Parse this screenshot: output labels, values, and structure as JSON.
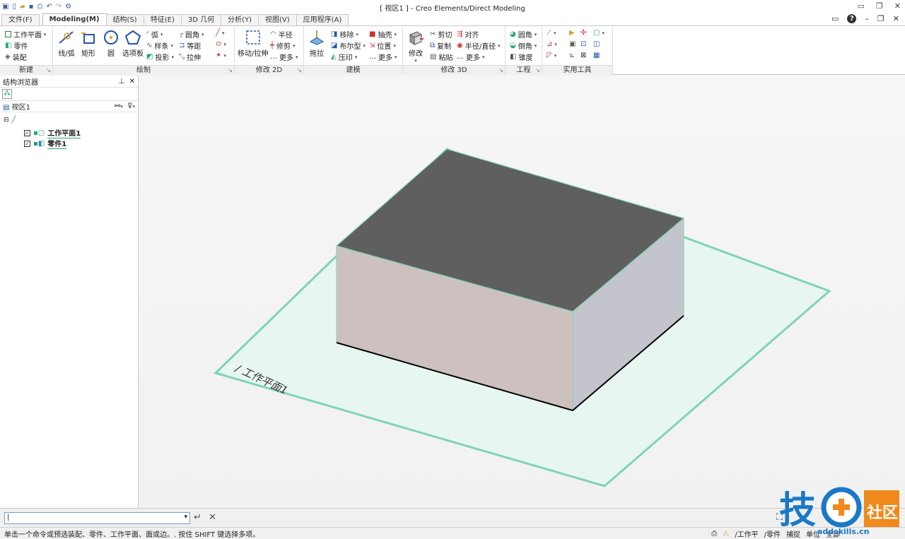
{
  "window": {
    "title": "[ 视区1 ] - Creo Elements/Direct Modeling"
  },
  "tabs": [
    {
      "label": "文件(F)"
    },
    {
      "label": "Modeling(M)"
    },
    {
      "label": "结构(S)"
    },
    {
      "label": "特征(E)"
    },
    {
      "label": "3D 几何"
    },
    {
      "label": "分析(Y)"
    },
    {
      "label": "视图(V)"
    },
    {
      "label": "应用程序(A)"
    }
  ],
  "ribbon": {
    "new": {
      "label": "新建",
      "items": [
        "工作平面",
        "零件",
        "装配"
      ]
    },
    "draw": {
      "label": "绘制",
      "line_arc": "线/弧",
      "rect": "矩形",
      "circle": "圆",
      "polygon": "选项板",
      "arc": "弧",
      "spline": "样条",
      "project": "投影",
      "fillet": "圆角",
      "offset": "等距",
      "stretch": "拉伸"
    },
    "modify2d": {
      "label": "修改 2D",
      "move": "移动/拉伸",
      "radius": "半径",
      "trim": "修剪",
      "more": "更多"
    },
    "model": {
      "label": "建模",
      "pull": "拖拉",
      "move": "移除",
      "boolean": "布尔型",
      "imprint": "压印",
      "shell": "抽壳",
      "position": "位置",
      "more": "更多"
    },
    "modify3d": {
      "label": "修改 3D",
      "modify": "修改",
      "cut": "剪切",
      "copy": "复制",
      "paste": "粘贴",
      "align": "对齐",
      "radius_dia": "半径/直径",
      "more": "更多"
    },
    "eng": {
      "label": "工程",
      "fillet": "圆角",
      "chamfer": "倒角",
      "taper": "锥度"
    },
    "tools": {
      "label": "实用工具"
    }
  },
  "browser": {
    "title": "结构浏览器",
    "view": "视区1",
    "items": [
      {
        "label": "工作平面1"
      },
      {
        "label": "零件1"
      }
    ]
  },
  "viewport": {
    "workplane_label": "/ 工作平面1"
  },
  "status": {
    "prompt": "单击一个命令或预选装配、零件、工作平面、面或边。. 按住 SHIFT 键选择多项。",
    "wp": "/工作平",
    "part": "/零件",
    "snap": "捕捉",
    "unit": "单位",
    "all": "全部"
  },
  "watermark": {
    "text": "技",
    "site": "addskills.cn",
    "badge": "社区"
  },
  "colors": {
    "top_face": "#5f5f5f",
    "front_face": "#cdc1bf",
    "side_face": "#c3c4cc",
    "plane": "#e8f6f1",
    "plane_edge": "#7fd3b7"
  }
}
